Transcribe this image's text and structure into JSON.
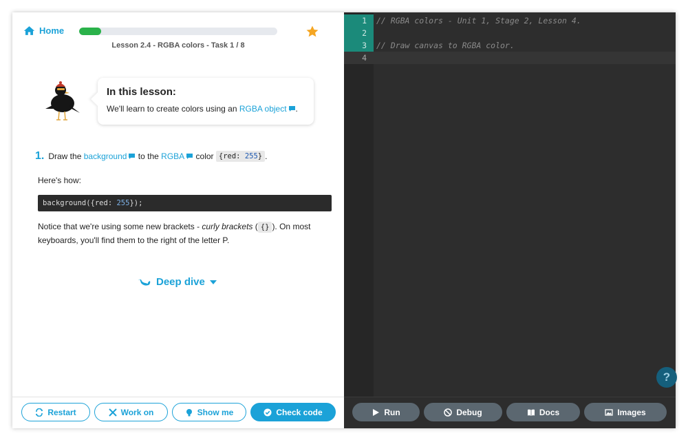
{
  "lesson": {
    "home_label": "Home",
    "title": "Lesson 2.4 - RGBA colors - Task 1 / 8",
    "progress_percent": 11
  },
  "intro": {
    "heading": "In this lesson:",
    "text_before": "We'll learn to create colors using an ",
    "link": "RGBA object",
    "text_after": "."
  },
  "task": {
    "number": "1.",
    "part1": "Draw the ",
    "link1": "background",
    "part2": " to the ",
    "link2": "RGBA",
    "part3": " color ",
    "code_prefix": "{red: ",
    "code_num": "255",
    "code_suffix": "}",
    "part4": ".",
    "heres_how": "Here's how:",
    "code_block_prefix": "background({red: ",
    "code_block_num": "255",
    "code_block_suffix": "});",
    "notice_1": "Notice that we're using some new brackets - ",
    "notice_em": "curly brackets",
    "notice_2": " (",
    "notice_code": "{}",
    "notice_3": "). On most keyboards, you'll find them to the right of the letter P."
  },
  "deep_dive": "Deep dive",
  "left_buttons": {
    "restart": "Restart",
    "work_on": "Work on",
    "show_me": "Show me",
    "check_code": "Check code"
  },
  "editor": {
    "lines": [
      {
        "num": "1",
        "code": "// RGBA colors - Unit 1, Stage 2, Lesson 4."
      },
      {
        "num": "2",
        "code": ""
      },
      {
        "num": "3",
        "code": "// Draw canvas to RGBA color."
      },
      {
        "num": "4",
        "code": ""
      }
    ],
    "help": "?"
  },
  "editor_buttons": {
    "run": "Run",
    "debug": "Debug",
    "docs": "Docs",
    "images": "Images"
  },
  "colors": {
    "accent": "#1ba2d8",
    "progress": "#2ab24a",
    "star": "#f5a623",
    "editor_bg": "#2d2d2d",
    "line_highlight": "#1b8a7a"
  }
}
